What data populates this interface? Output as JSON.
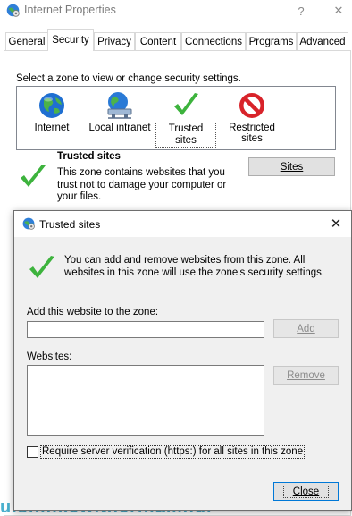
{
  "parent_window": {
    "title": "Internet Properties",
    "help_glyph": "?",
    "close_glyph": "✕",
    "tabs": [
      {
        "label": "General",
        "active": false
      },
      {
        "label": "Security",
        "active": true
      },
      {
        "label": "Privacy",
        "active": false
      },
      {
        "label": "Content",
        "active": false
      },
      {
        "label": "Connections",
        "active": false
      },
      {
        "label": "Programs",
        "active": false
      },
      {
        "label": "Advanced",
        "active": false
      }
    ],
    "zone_prompt": "Select a zone to view or change security settings.",
    "zones": [
      {
        "label": "Internet",
        "icon": "globe-icon",
        "selected": false
      },
      {
        "label": "Local intranet",
        "icon": "network-globe-icon",
        "selected": false
      },
      {
        "label": "Trusted sites",
        "icon": "checkmark-icon",
        "selected": true
      },
      {
        "label": "Restricted sites",
        "label_line1": "Restricted",
        "label_line2": "sites",
        "icon": "no-entry-icon",
        "selected": false
      }
    ],
    "zone_detail": {
      "name": "Trusted sites",
      "description": "This zone contains websites that you trust not to damage your computer or your files.",
      "sites_button": "Sites"
    },
    "watermark_text": "uishilikewitherhiamhui"
  },
  "dialog": {
    "title": "Trusted sites",
    "close_glyph": "✕",
    "info_text": "You can add and remove websites from this zone. All websites in this zone will use the zone's security settings.",
    "add_label": "Add this website to the zone:",
    "add_value": "",
    "add_button": "Add",
    "websites_label": "Websites:",
    "websites": [],
    "remove_button": "Remove",
    "https_checkbox_label": "Require server verification (https:) for all sites in this zone",
    "https_checked": false,
    "close_button": "Close"
  },
  "colors": {
    "check_green": "#3db33d",
    "globe_blue": "#1f6fd1",
    "no_entry_red": "#d8232a",
    "dialog_bg": "#f0f0f0",
    "focus_blue": "#0078d7"
  }
}
